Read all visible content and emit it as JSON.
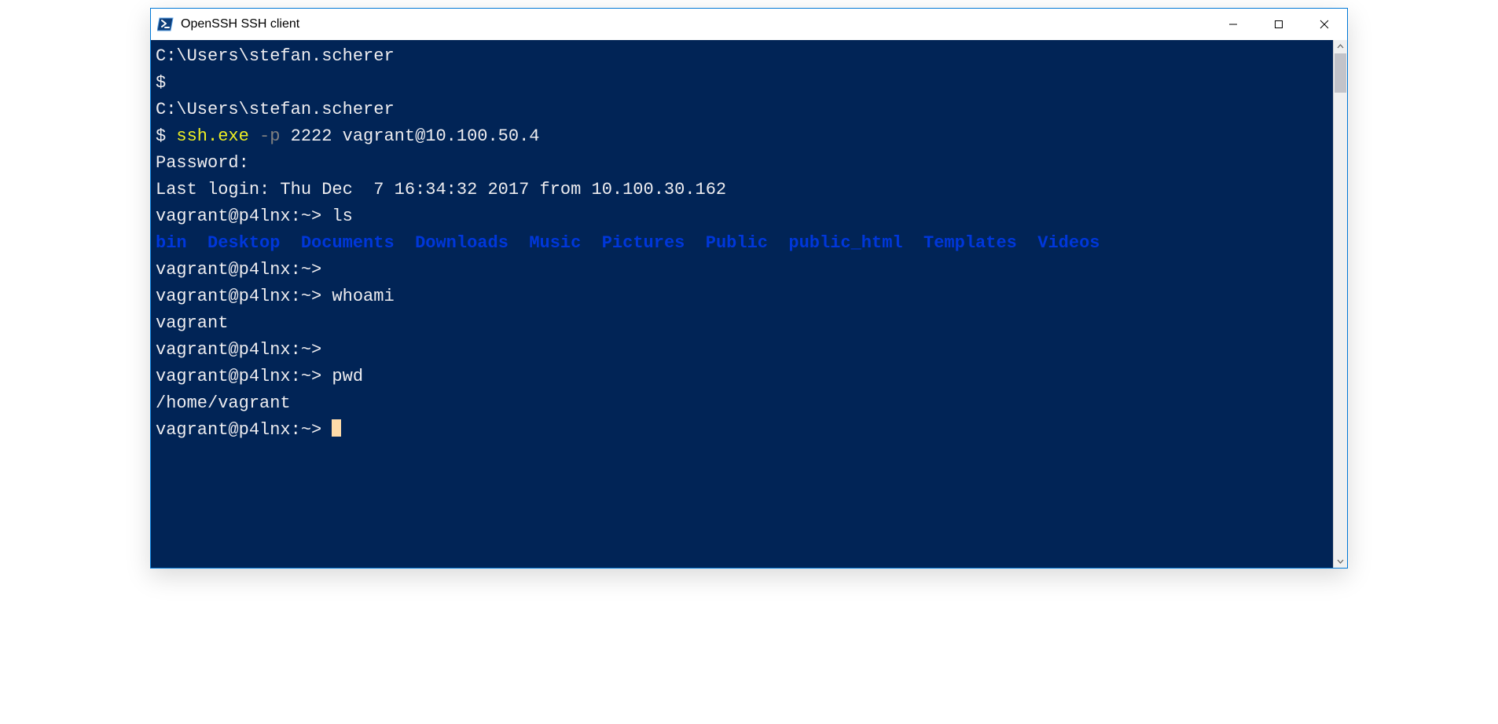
{
  "window": {
    "title": "OpenSSH SSH client"
  },
  "terminal": {
    "path": "C:\\Users\\stefan.scherer",
    "prompt": "$",
    "ssh_cmd": {
      "exe": "ssh.exe",
      "flag": " -p",
      "args": " 2222 vagrant@10.100.50.4"
    },
    "password_prompt": "Password:",
    "last_login": "Last login: Thu Dec  7 16:34:32 2017 from 10.100.30.162",
    "remote_prompt": "vagrant@p4lnx:~>",
    "cmd_ls": " ls",
    "ls_output": {
      "bin": "bin",
      "Desktop": "Desktop",
      "Documents": "Documents",
      "Downloads": "Downloads",
      "Music": "Music",
      "Pictures": "Pictures",
      "Public": "Public",
      "public_html": "public_html",
      "Templates": "Templates",
      "Videos": "Videos"
    },
    "cmd_whoami": " whoami",
    "whoami_output": "vagrant",
    "cmd_pwd": " pwd",
    "pwd_output": "/home/vagrant"
  }
}
